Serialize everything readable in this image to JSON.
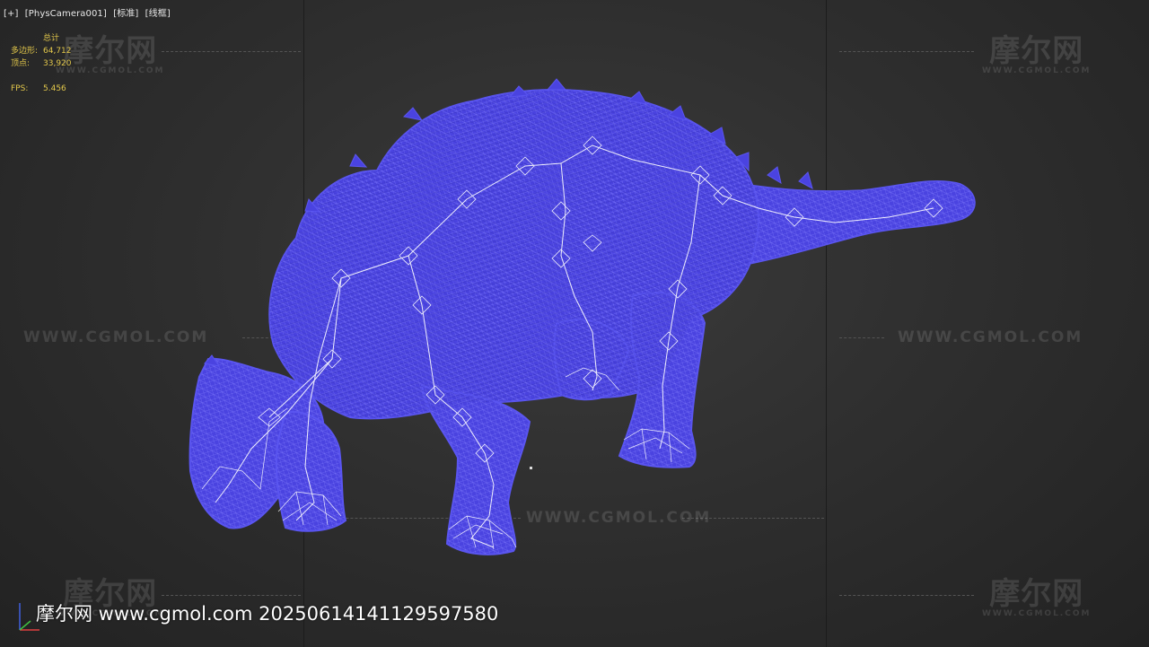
{
  "viewport": {
    "menu_plus": "[+]",
    "camera": "[PhysCamera001]",
    "shading_mode": "[标准]",
    "render_mode": "[线框]"
  },
  "stats": {
    "header": "总计",
    "polygons_label": "多边形:",
    "polygons_value": "64,712",
    "vertices_label": "顶点:",
    "vertices_value": "33,920",
    "fps_label": "FPS:",
    "fps_value": "5.456"
  },
  "watermarks": {
    "logo_text": "摩尔网",
    "logo_sub": "WWW.CGMOL.COM",
    "url_text": "WWW.CGMOL.COM",
    "bottom_text": "摩尔网 www.cgmol.com 20250614141129597580"
  },
  "model": {
    "subject": "ankylosaurus wireframe with bone rig",
    "wire_color": "#4a43e0",
    "wire_dark_color": "#3a33c8",
    "bone_color": "#ffffff"
  },
  "axis_gizmo": {
    "x_color": "#e04040",
    "y_color": "#40c040",
    "z_color": "#4060e0"
  }
}
